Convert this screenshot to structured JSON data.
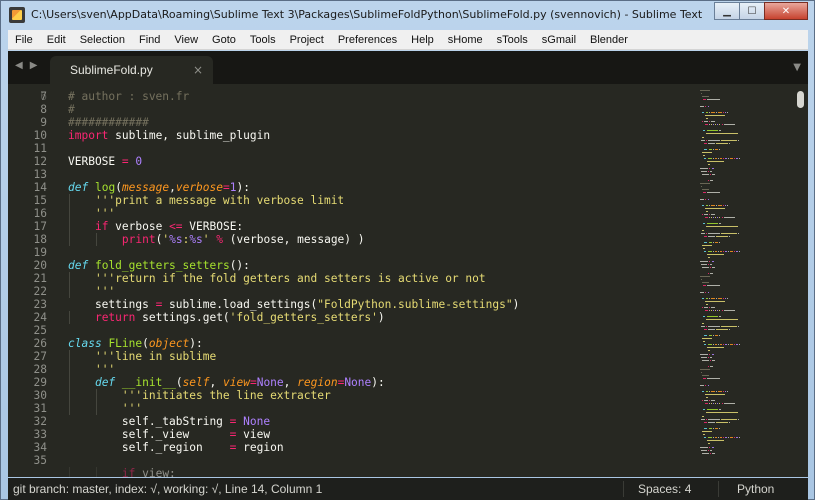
{
  "window": {
    "title": "C:\\Users\\sven\\AppData\\Roaming\\Sublime Text 3\\Packages\\SublimeFoldPython\\SublimeFold.py (svennovich) - Sublime Text",
    "minimize_glyph": "▁",
    "maximize_glyph": "☐",
    "close_glyph": "✕"
  },
  "menu": [
    "File",
    "Edit",
    "Selection",
    "Find",
    "View",
    "Goto",
    "Tools",
    "Project",
    "Preferences",
    "Help",
    "sHome",
    "sTools",
    "sGmail",
    "Blender"
  ],
  "tabs": [
    {
      "label": "SublimeFold.py",
      "close_glyph": "×"
    }
  ],
  "nav": {
    "back_glyph": "◀",
    "forward_glyph": "▶",
    "dropdown_glyph": "▼"
  },
  "code": {
    "lines": [
      {
        "n": "7",
        "tokens": [
          [
            "c",
            "# author : sven.fr"
          ]
        ]
      },
      {
        "n": "8",
        "tokens": [
          [
            "c",
            "#"
          ]
        ]
      },
      {
        "n": "9",
        "tokens": [
          [
            "c",
            "############"
          ]
        ]
      },
      {
        "n": "10",
        "tokens": [
          [
            "k",
            "import"
          ],
          [
            "t",
            " sublime, sublime_plugin"
          ]
        ]
      },
      {
        "n": "11",
        "tokens": []
      },
      {
        "n": "12",
        "tokens": [
          [
            "t",
            "VERBOSE "
          ],
          [
            "k",
            "="
          ],
          [
            "t",
            " "
          ],
          [
            "n",
            "0"
          ]
        ]
      },
      {
        "n": "13",
        "tokens": []
      },
      {
        "n": "14",
        "tokens": [
          [
            "d",
            "def"
          ],
          [
            "t",
            " "
          ],
          [
            "fn",
            "log"
          ],
          [
            "t",
            "("
          ],
          [
            "p",
            "message"
          ],
          [
            "t",
            ","
          ],
          [
            "p",
            "verbose"
          ],
          [
            "k",
            "="
          ],
          [
            "n",
            "1"
          ],
          [
            "t",
            "):"
          ]
        ]
      },
      {
        "n": "15",
        "tokens": [
          [
            "t",
            "    "
          ],
          [
            "s",
            "'''print a message with verbose limit"
          ]
        ]
      },
      {
        "n": "16",
        "tokens": [
          [
            "t",
            "    "
          ],
          [
            "s",
            "'''"
          ]
        ]
      },
      {
        "n": "17",
        "tokens": [
          [
            "t",
            "    "
          ],
          [
            "k",
            "if"
          ],
          [
            "t",
            " verbose "
          ],
          [
            "k",
            "<="
          ],
          [
            "t",
            " VERBOSE:"
          ]
        ]
      },
      {
        "n": "18",
        "tokens": [
          [
            "t",
            "        "
          ],
          [
            "k",
            "print"
          ],
          [
            "t",
            "("
          ],
          [
            "s",
            "'"
          ],
          [
            "n",
            "%s"
          ],
          [
            "s",
            ":"
          ],
          [
            "n",
            "%s"
          ],
          [
            "s",
            "'"
          ],
          [
            "t",
            " "
          ],
          [
            "k",
            "%"
          ],
          [
            "t",
            " (verbose, message) )"
          ]
        ]
      },
      {
        "n": "19",
        "tokens": []
      },
      {
        "n": "20",
        "tokens": [
          [
            "d",
            "def"
          ],
          [
            "t",
            " "
          ],
          [
            "fn",
            "fold_getters_setters"
          ],
          [
            "t",
            "():"
          ]
        ]
      },
      {
        "n": "21",
        "tokens": [
          [
            "t",
            "    "
          ],
          [
            "s",
            "'''return if the fold getters and setters is active or not"
          ]
        ]
      },
      {
        "n": "22",
        "tokens": [
          [
            "t",
            "    "
          ],
          [
            "s",
            "'''"
          ]
        ]
      },
      {
        "n": "23",
        "tokens": [
          [
            "t",
            "    settings "
          ],
          [
            "k",
            "="
          ],
          [
            "t",
            " sublime.load_settings("
          ],
          [
            "s",
            "\"FoldPython.sublime-settings\""
          ],
          [
            "t",
            ")"
          ]
        ]
      },
      {
        "n": "24",
        "tokens": [
          [
            "t",
            "    "
          ],
          [
            "k",
            "return"
          ],
          [
            "t",
            " settings.get("
          ],
          [
            "s",
            "'fold_getters_setters'"
          ],
          [
            "t",
            ")"
          ]
        ]
      },
      {
        "n": "25",
        "tokens": []
      },
      {
        "n": "26",
        "tokens": [
          [
            "d",
            "class"
          ],
          [
            "t",
            " "
          ],
          [
            "fn",
            "FLine"
          ],
          [
            "t",
            "("
          ],
          [
            "p",
            "object"
          ],
          [
            "t",
            "):"
          ]
        ]
      },
      {
        "n": "27",
        "tokens": [
          [
            "t",
            "    "
          ],
          [
            "s",
            "'''line in sublime"
          ]
        ]
      },
      {
        "n": "28",
        "tokens": [
          [
            "t",
            "    "
          ],
          [
            "s",
            "'''"
          ]
        ]
      },
      {
        "n": "29",
        "tokens": [
          [
            "t",
            "    "
          ],
          [
            "d",
            "def"
          ],
          [
            "t",
            " "
          ],
          [
            "fn",
            "__init__"
          ],
          [
            "t",
            "("
          ],
          [
            "p",
            "self"
          ],
          [
            "t",
            ", "
          ],
          [
            "p",
            "view"
          ],
          [
            "k",
            "="
          ],
          [
            "n",
            "None"
          ],
          [
            "t",
            ", "
          ],
          [
            "p",
            "region"
          ],
          [
            "k",
            "="
          ],
          [
            "n",
            "None"
          ],
          [
            "t",
            "):"
          ]
        ]
      },
      {
        "n": "30",
        "tokens": [
          [
            "t",
            "        "
          ],
          [
            "s",
            "'''initiates the line extracter"
          ]
        ]
      },
      {
        "n": "31",
        "tokens": [
          [
            "t",
            "        "
          ],
          [
            "s",
            "'''"
          ]
        ]
      },
      {
        "n": "32",
        "tokens": [
          [
            "t",
            "        self._tabString "
          ],
          [
            "k",
            "="
          ],
          [
            "t",
            " "
          ],
          [
            "n",
            "None"
          ]
        ]
      },
      {
        "n": "33",
        "tokens": [
          [
            "t",
            "        self._view      "
          ],
          [
            "k",
            "="
          ],
          [
            "t",
            " view"
          ]
        ]
      },
      {
        "n": "34",
        "tokens": [
          [
            "t",
            "        self._region    "
          ],
          [
            "k",
            "="
          ],
          [
            "t",
            " region"
          ]
        ]
      },
      {
        "n": "35",
        "tokens": []
      },
      {
        "n": "",
        "tokens": [
          [
            "t",
            "        "
          ],
          [
            "k",
            "if"
          ],
          [
            "t",
            " view:"
          ]
        ]
      }
    ]
  },
  "status": {
    "left": "git branch: master, index: √, working: √, Line 14, Column 1",
    "spaces": "Spaces: 4",
    "syntax": "Python"
  },
  "colors": {
    "background": "#272822",
    "keyword": "#f92672",
    "storage": "#66d9ef",
    "function": "#a6e22e",
    "parameter": "#fd971f",
    "constant": "#ae81ff",
    "string": "#e6db74",
    "comment": "#75715e"
  }
}
